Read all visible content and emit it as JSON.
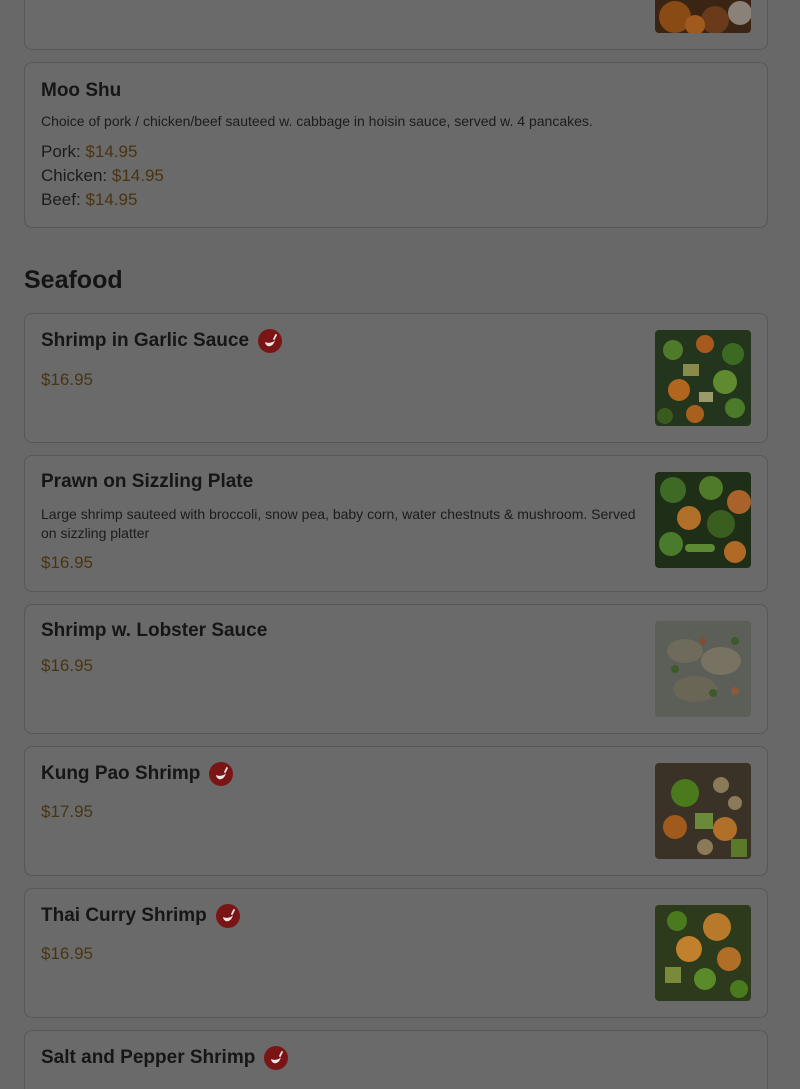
{
  "colors": {
    "overlay_bg": "#686868",
    "card_bg": "#6a6a6a",
    "price": "#4a3410",
    "spicy": "#7a1515"
  },
  "prev_item": {},
  "moo_shu": {
    "name": "Moo Shu",
    "description": "Choice of pork / chicken/beef sauteed w. cabbage in hoisin sauce, served w. 4 pancakes.",
    "options": [
      {
        "label": "Pork:",
        "price": "$14.95"
      },
      {
        "label": "Chicken:",
        "price": "$14.95"
      },
      {
        "label": "Beef:",
        "price": "$14.95"
      }
    ]
  },
  "section": {
    "title": "Seafood"
  },
  "items": [
    {
      "name": "Shrimp in Garlic Sauce",
      "spicy": true,
      "description": "",
      "price": "$16.95",
      "image": "stir-fry-vegetables"
    },
    {
      "name": "Prawn on Sizzling Plate",
      "spicy": false,
      "description": "Large shrimp sauteed with broccoli, snow pea, baby corn, water chestnuts & mushroom. Served on sizzling platter",
      "price": "$16.95",
      "image": "broccoli-prawns"
    },
    {
      "name": "Shrimp w. Lobster Sauce",
      "spicy": false,
      "description": "",
      "price": "$16.95",
      "image": "lobster-sauce"
    },
    {
      "name": "Kung Pao Shrimp",
      "spicy": true,
      "description": "",
      "price": "$17.95",
      "image": "kung-pao"
    },
    {
      "name": "Thai Curry Shrimp",
      "spicy": true,
      "description": "",
      "price": "$16.95",
      "image": "curry-shrimp"
    },
    {
      "name": "Salt and Pepper Shrimp",
      "spicy": true,
      "description": "",
      "price": "",
      "image": ""
    }
  ]
}
